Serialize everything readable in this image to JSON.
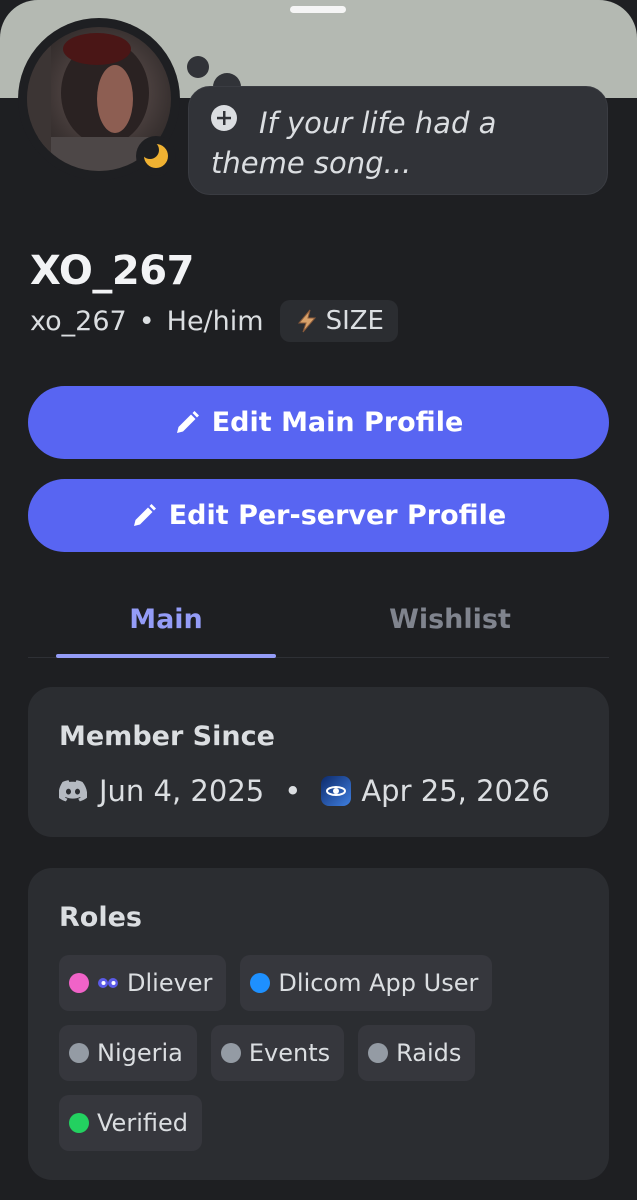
{
  "profile": {
    "status_prompt": "If your life had a theme song...",
    "display_name": "XO_267",
    "username": "xo_267",
    "separator": "•",
    "pronouns": "He/him",
    "tag_label": "SIZE",
    "status": "idle"
  },
  "actions": {
    "edit_main": "Edit Main Profile",
    "edit_server": "Edit Per-server Profile"
  },
  "tabs": [
    {
      "label": "Main",
      "active": true
    },
    {
      "label": "Wishlist",
      "active": false
    }
  ],
  "member_since": {
    "title": "Member Since",
    "discord_date": "Jun 4, 2025",
    "separator": "•",
    "server_date": "Apr 25, 2026"
  },
  "roles": {
    "title": "Roles",
    "items": [
      {
        "label": "Dliever",
        "color": "#f063c8"
      },
      {
        "label": "Dlicom App User",
        "color": "#1e90ff"
      },
      {
        "label": "Nigeria",
        "color": "#949ba4"
      },
      {
        "label": "Events",
        "color": "#949ba4"
      },
      {
        "label": "Raids",
        "color": "#949ba4"
      },
      {
        "label": "Verified",
        "color": "#23d160"
      }
    ]
  },
  "colors": {
    "accent": "#5865f2",
    "tab_active": "#949cf7",
    "background": "#1e1f22",
    "banner": "#b4b9b2",
    "card": "#2b2d31",
    "idle_status": "#f0b232"
  }
}
